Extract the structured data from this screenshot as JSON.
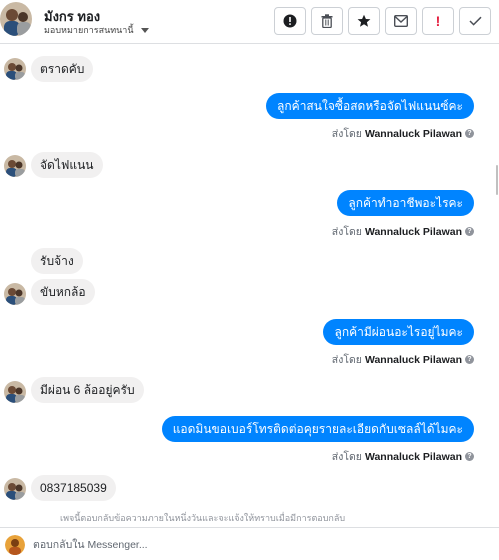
{
  "header": {
    "contact_name": "มังกร ทอง",
    "assign_label": "มอบหมายการสนทนานี้",
    "actions": [
      {
        "icon": "alert-circle-icon",
        "symbol": "!"
      },
      {
        "icon": "trash-icon",
        "symbol": "🗑"
      },
      {
        "icon": "star-icon",
        "symbol": "★"
      },
      {
        "icon": "mark-unread-icon",
        "symbol": "✉"
      },
      {
        "icon": "spam-icon",
        "symbol": "!"
      },
      {
        "icon": "done-check-icon",
        "symbol": "✓"
      }
    ]
  },
  "messages": [
    {
      "dir": "in",
      "text": "ตราดคับ"
    },
    {
      "dir": "out",
      "text": "ลูกค้าสนใจซื้อสดหรือจัดไฟแนนซ์คะ",
      "sent_by_prefix": "ส่งโดย",
      "sender": "Wannaluck Pilawan"
    },
    {
      "dir": "in",
      "text": "จัดไฟแนน"
    },
    {
      "dir": "out",
      "text": "ลูกค้าทำอาชีพอะไรคะ",
      "sent_by_prefix": "ส่งโดย",
      "sender": "Wannaluck Pilawan"
    },
    {
      "dir": "in",
      "text": "รับจ้าง"
    },
    {
      "dir": "in",
      "text": "ขับหกล้อ"
    },
    {
      "dir": "out",
      "text": "ลูกค้ามีผ่อนอะไรอยู่ไมคะ",
      "sent_by_prefix": "ส่งโดย",
      "sender": "Wannaluck Pilawan"
    },
    {
      "dir": "in",
      "text": "มีผ่อน 6 ล้ออยู่ครับ"
    },
    {
      "dir": "out",
      "text": "แอดมินขอเบอร์โทรติดต่อคุยรายละเอียดกับเซลล์ได้ไมคะ",
      "sent_by_prefix": "ส่งโดย",
      "sender": "Wannaluck Pilawan"
    },
    {
      "dir": "in",
      "text": "0837185039"
    }
  ],
  "policy_note": "เพจนี้ตอบกลับข้อความภายในหนึ่งวันและจะแจ้งให้ทราบเมื่อมีการตอบกลับ",
  "composer": {
    "placeholder": "ตอบกลับใน Messenger..."
  },
  "colors": {
    "accent": "#0084ff",
    "incoming_bubble": "#f1f0f0",
    "spam_red": "#e41e3f"
  }
}
